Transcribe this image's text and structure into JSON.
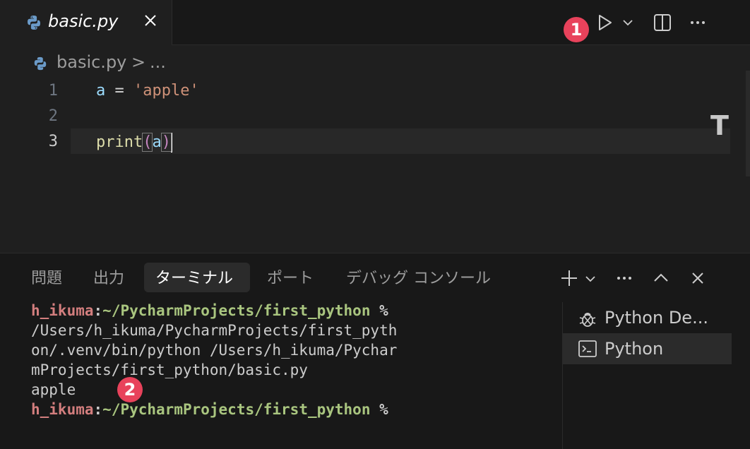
{
  "editor_tab": {
    "title": "basic.py",
    "icon": "python-icon"
  },
  "toolbar": {
    "run_icon": "play-icon",
    "dropdown_icon": "chevron-down-icon",
    "split_icon": "split-editor-icon",
    "more_icon": "ellipsis-icon"
  },
  "annotations": {
    "badge1": "1",
    "badge2": "2",
    "color": "#e8425b"
  },
  "breadcrumb": {
    "file": "basic.py",
    "separator": ">",
    "more": "..."
  },
  "code": {
    "line_numbers": [
      "1",
      "2",
      "3"
    ],
    "active_line": 3,
    "line1": {
      "var": "a",
      "op": " = ",
      "str": "'apple'"
    },
    "line3": {
      "fn": "print",
      "open": "(",
      "arg": "a",
      "close": ")"
    }
  },
  "side_marker": "T",
  "panel": {
    "tabs": [
      "問題",
      "出力",
      "ターミナル",
      "ポート",
      "デバッグ コンソール"
    ],
    "active_tab": "ターミナル"
  },
  "terminal": {
    "prompt1": {
      "user": "h_ikuma",
      "sep": ":",
      "path": "~/PycharmProjects/first_python",
      "sym": " %"
    },
    "cmd_lines": [
      "/Users/h_ikuma/PycharmProjects/first_pyth",
      "on/.venv/bin/python /Users/h_ikuma/Pychar",
      "mProjects/first_python/basic.py"
    ],
    "output": "apple",
    "prompt2": {
      "user": "h_ikuma",
      "sep": ":",
      "path": "~/PycharmProjects/first_python",
      "sym": " %"
    }
  },
  "terminal_list": [
    {
      "label": "Python De...",
      "icon": "debug-icon"
    },
    {
      "label": "Python",
      "icon": "terminal-icon"
    }
  ],
  "colors": {
    "background": "#1f1f1f",
    "panel": "#181818",
    "string": "#ce9178",
    "variable": "#9cdcfe",
    "prompt_user": "#d37e7e",
    "prompt_path": "#a9c57f"
  }
}
